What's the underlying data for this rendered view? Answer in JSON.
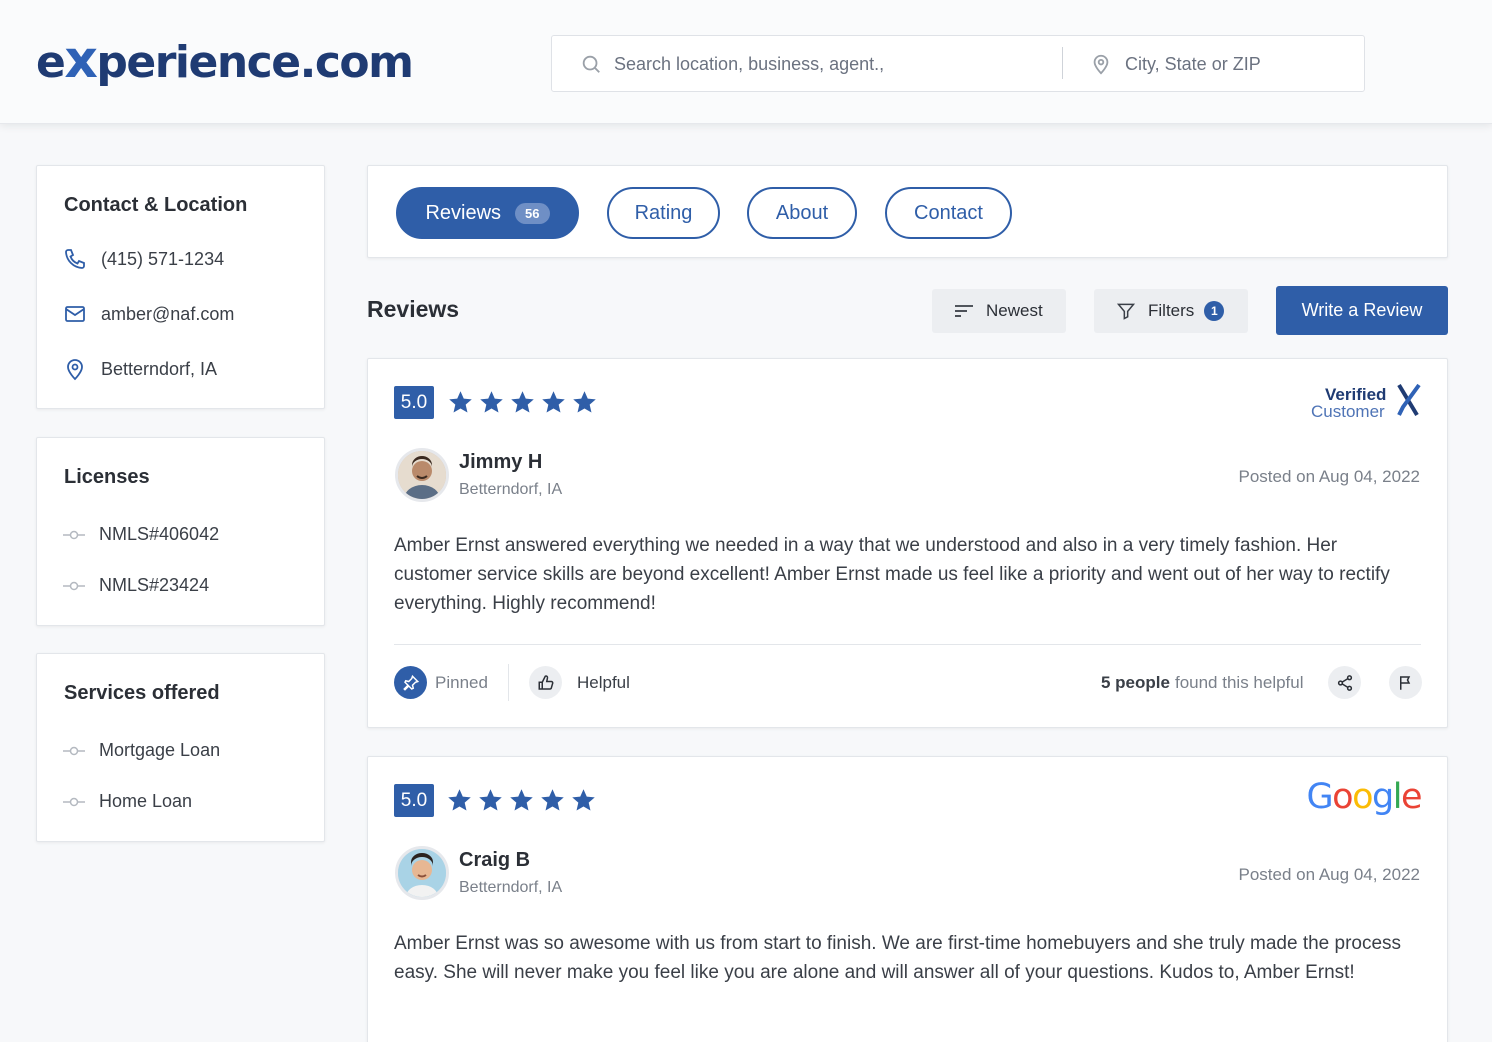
{
  "header": {
    "logo_pre": "e",
    "logo_x": "x",
    "logo_post": "perience.com",
    "search_placeholder": "Search location, business, agent.,",
    "location_placeholder": "City, State or ZIP"
  },
  "sidebar": {
    "contact": {
      "title": "Contact & Location",
      "phone": "(415) 571-1234",
      "email": "amber@naf.com",
      "location": "Betterndorf, IA"
    },
    "licenses": {
      "title": "Licenses",
      "items": [
        "NMLS#406042",
        "NMLS#23424"
      ]
    },
    "services": {
      "title": "Services offered",
      "items": [
        "Mortgage Loan",
        "Home Loan"
      ]
    }
  },
  "tabs": {
    "reviews_label": "Reviews",
    "reviews_count": "56",
    "rating_label": "Rating",
    "about_label": "About",
    "contact_label": "Contact"
  },
  "reviews_section": {
    "title": "Reviews",
    "sort_label": "Newest",
    "filters_label": "Filters",
    "filters_count": "1",
    "write_label": "Write a Review"
  },
  "colors": {
    "primary": "#2f5ea8",
    "brand_dark": "#1f3b73",
    "star": "#2f5ea8"
  },
  "reviews": [
    {
      "score": "5.0",
      "stars": 5,
      "source_line1": "Verified",
      "source_line2": "Customer",
      "name": "Jimmy H",
      "location": "Betterndorf, IA",
      "date": "Posted on Aug 04, 2022",
      "text": "Amber Ernst answered everything we needed in a way that we understood and also in a very timely fashion. Her customer service skills are beyond excellent! Amber Ernst made us feel like a priority and went out of her way to rectify everything. Highly recommend!",
      "pinned_label": "Pinned",
      "helpful_label": "Helpful",
      "helpful_count": "5 people",
      "helpful_suffix": "found this helpful"
    },
    {
      "score": "5.0",
      "stars": 5,
      "source": "Google",
      "name": "Craig B",
      "location": "Betterndorf, IA",
      "date": "Posted on Aug 04, 2022",
      "text": "Amber Ernst was so awesome with us from start to finish. We are first-time homebuyers and she truly made the process easy. She will never make you feel like you are alone and will answer all of your questions. Kudos to, Amber Ernst!"
    }
  ]
}
